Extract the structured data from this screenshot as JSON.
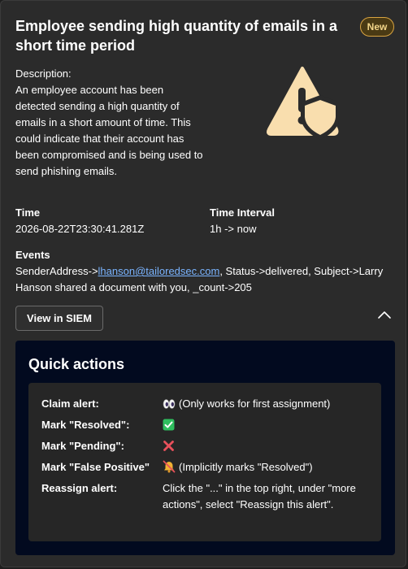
{
  "alert": {
    "title": "Employee sending high quantity of emails in a short time period",
    "badge": "New",
    "description_label": "Description:",
    "description": "An employee account has been detected sending a high quantity of emails in a short amount of time. This could indicate that their account has been compromised and is being used to send phishing emails.",
    "hero_icon": "warning-shield-icon"
  },
  "details": {
    "time_label": "Time",
    "time_value": "2026-08-22T23:30:41.281Z",
    "interval_label": "Time Interval",
    "interval_value": "1h -> now",
    "events_label": "Events",
    "events_prefix": "SenderAddress->",
    "events_email": "lhanson@tailoredsec.com",
    "events_suffix": ", Status->delivered, Subject->Larry Hanson shared a document with you, _count->205"
  },
  "actions": {
    "siem_button": "View in SIEM",
    "collapse_icon": "chevron-up-icon"
  },
  "quick_actions": {
    "title": "Quick actions",
    "rows": [
      {
        "label": "Claim alert:",
        "icon": "eyes-icon",
        "value": "(Only works for first assignment)"
      },
      {
        "label": "Mark \"Resolved\":",
        "icon": "check-mark-icon",
        "value": ""
      },
      {
        "label": "Mark \"Pending\":",
        "icon": "cross-mark-icon",
        "value": ""
      },
      {
        "label": "Mark \"False Positive\"",
        "icon": "muted-bell-icon",
        "value": "(Implicitly marks \"Resolved\")"
      },
      {
        "label": "Reassign alert:",
        "icon": "",
        "value": "Click the \"...\" in the top right, under \"more actions\", select \"Reassign this alert\"."
      }
    ]
  },
  "colors": {
    "card_bg": "#2b2b2b",
    "panel_bg": "#020a1f",
    "accent": "#f9deae",
    "link": "#7ab4ff",
    "badge_border": "#d9a441",
    "check_green": "#2fbf5f",
    "cross_red": "#e8505b"
  }
}
